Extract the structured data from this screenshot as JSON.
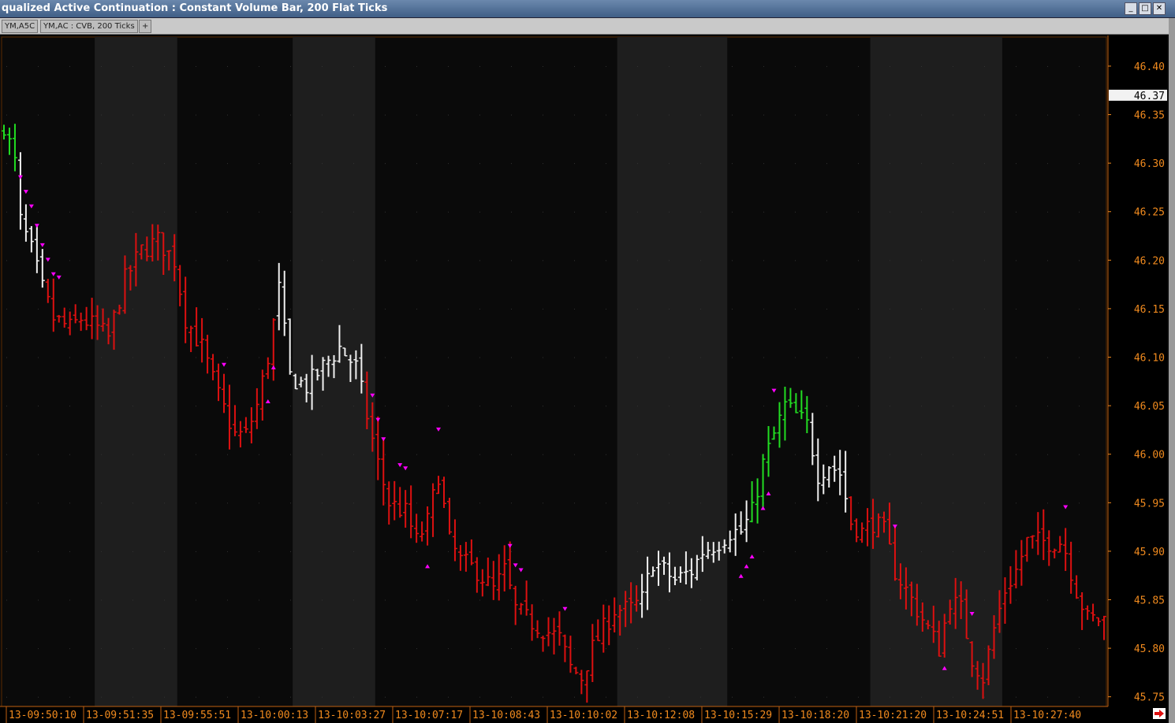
{
  "window": {
    "title": "qualized Active Continuation : Constant Volume Bar, 200 Flat Ticks",
    "buttons": {
      "minimize": "_",
      "maximize": "□",
      "close": "✕"
    }
  },
  "tabs": [
    {
      "label": "YM,A5C"
    },
    {
      "label": "YM,AC : CVB, 200 Ticks"
    },
    {
      "label": "+"
    }
  ],
  "colors": {
    "background": "#0a0a0a",
    "band": "#1e1e1e",
    "axis_text": "#f08a1e",
    "up": "#22dd22",
    "down": "#dd1010",
    "neutral": "#f0f0f0",
    "marker": "#ff00ff"
  },
  "chart_data": {
    "type": "bar",
    "style": "ohlc",
    "ylim": [
      45.74,
      46.43
    ],
    "yticks": [
      "46.40",
      "46.35",
      "46.30",
      "46.25",
      "46.20",
      "46.15",
      "46.10",
      "46.05",
      "46.00",
      "45.95",
      "45.90",
      "45.85",
      "45.80",
      "45.75"
    ],
    "current_price": "46.37",
    "xticks": [
      "13-09:50:10",
      "13-09:51:35",
      "13-09:55:51",
      "13-10:00:13",
      "13-10:03:27",
      "13-10:07:17",
      "13-10:08:43",
      "13-10:10:02",
      "13-10:12:08",
      "13-10:15:29",
      "13-10:18:20",
      "13-10:21:20",
      "13-10:24:51",
      "13-10:27:40"
    ],
    "n_bars": 201,
    "shaded_bar_ranges": [
      [
        17,
        31
      ],
      [
        53,
        67
      ],
      [
        112,
        131
      ],
      [
        158,
        181
      ]
    ],
    "segments": [
      {
        "bars": [
          0,
          3
        ],
        "color": "up"
      },
      {
        "bars": [
          3,
          8
        ],
        "color": "neutral"
      },
      {
        "bars": [
          8,
          50
        ],
        "color": "down"
      },
      {
        "bars": [
          50,
          66
        ],
        "color": "neutral"
      },
      {
        "bars": [
          66,
          116
        ],
        "color": "down"
      },
      {
        "bars": [
          116,
          136
        ],
        "color": "neutral"
      },
      {
        "bars": [
          136,
          147
        ],
        "color": "up"
      },
      {
        "bars": [
          147,
          154
        ],
        "color": "neutral"
      },
      {
        "bars": [
          154,
          201
        ],
        "color": "down"
      }
    ],
    "path_points": [
      [
        0,
        46.34
      ],
      [
        2,
        46.3
      ],
      [
        3,
        46.24
      ],
      [
        5,
        46.21
      ],
      [
        7,
        46.17
      ],
      [
        9,
        46.14
      ],
      [
        12,
        46.13
      ],
      [
        14,
        46.14
      ],
      [
        17,
        46.13
      ],
      [
        19,
        46.12
      ],
      [
        22,
        46.18
      ],
      [
        25,
        46.21
      ],
      [
        28,
        46.22
      ],
      [
        31,
        46.2
      ],
      [
        33,
        46.14
      ],
      [
        36,
        46.11
      ],
      [
        39,
        46.06
      ],
      [
        42,
        46.02
      ],
      [
        44,
        46.02
      ],
      [
        46,
        46.05
      ],
      [
        48,
        46.1
      ],
      [
        50,
        46.17
      ],
      [
        52,
        46.08
      ],
      [
        55,
        46.07
      ],
      [
        58,
        46.09
      ],
      [
        61,
        46.11
      ],
      [
        64,
        46.09
      ],
      [
        66,
        46.04
      ],
      [
        68,
        45.99
      ],
      [
        70,
        45.95
      ],
      [
        73,
        45.94
      ],
      [
        75,
        45.91
      ],
      [
        77,
        45.93
      ],
      [
        79,
        45.98
      ],
      [
        81,
        45.91
      ],
      [
        83,
        45.89
      ],
      [
        86,
        45.88
      ],
      [
        89,
        45.86
      ],
      [
        91,
        45.88
      ],
      [
        93,
        45.84
      ],
      [
        95,
        45.83
      ],
      [
        98,
        45.82
      ],
      [
        101,
        45.81
      ],
      [
        103,
        45.78
      ],
      [
        105,
        45.77
      ],
      [
        107,
        45.8
      ],
      [
        109,
        45.82
      ],
      [
        111,
        45.84
      ],
      [
        114,
        45.84
      ],
      [
        116,
        45.85
      ],
      [
        118,
        45.89
      ],
      [
        120,
        45.88
      ],
      [
        122,
        45.87
      ],
      [
        125,
        45.88
      ],
      [
        127,
        45.9
      ],
      [
        130,
        45.91
      ],
      [
        132,
        45.92
      ],
      [
        134,
        45.92
      ],
      [
        136,
        45.94
      ],
      [
        138,
        45.99
      ],
      [
        140,
        46.02
      ],
      [
        142,
        46.05
      ],
      [
        144,
        46.04
      ],
      [
        146,
        46.03
      ],
      [
        148,
        45.98
      ],
      [
        150,
        45.99
      ],
      [
        152,
        45.98
      ],
      [
        154,
        45.93
      ],
      [
        156,
        45.92
      ],
      [
        158,
        45.93
      ],
      [
        160,
        45.92
      ],
      [
        162,
        45.88
      ],
      [
        164,
        45.86
      ],
      [
        166,
        45.84
      ],
      [
        168,
        45.82
      ],
      [
        170,
        45.8
      ],
      [
        172,
        45.85
      ],
      [
        174,
        45.84
      ],
      [
        176,
        45.79
      ],
      [
        178,
        45.77
      ],
      [
        180,
        45.82
      ],
      [
        182,
        45.86
      ],
      [
        184,
        45.88
      ],
      [
        186,
        45.91
      ],
      [
        188,
        45.91
      ],
      [
        190,
        45.91
      ],
      [
        192,
        45.91
      ],
      [
        193,
        45.9
      ],
      [
        195,
        45.86
      ],
      [
        197,
        45.83
      ],
      [
        200,
        45.83
      ]
    ],
    "markers": [
      {
        "bar": 3,
        "dir": "down"
      },
      {
        "bar": 4,
        "dir": "down"
      },
      {
        "bar": 5,
        "dir": "down"
      },
      {
        "bar": 6,
        "dir": "down"
      },
      {
        "bar": 7,
        "dir": "down"
      },
      {
        "bar": 8,
        "dir": "down"
      },
      {
        "bar": 9,
        "dir": "down"
      },
      {
        "bar": 10,
        "dir": "down"
      },
      {
        "bar": 40,
        "dir": "down"
      },
      {
        "bar": 48,
        "dir": "up"
      },
      {
        "bar": 49,
        "dir": "up"
      },
      {
        "bar": 67,
        "dir": "down"
      },
      {
        "bar": 68,
        "dir": "down"
      },
      {
        "bar": 69,
        "dir": "down"
      },
      {
        "bar": 72,
        "dir": "down"
      },
      {
        "bar": 73,
        "dir": "down"
      },
      {
        "bar": 77,
        "dir": "up"
      },
      {
        "bar": 79,
        "dir": "down"
      },
      {
        "bar": 92,
        "dir": "down"
      },
      {
        "bar": 93,
        "dir": "down"
      },
      {
        "bar": 94,
        "dir": "down"
      },
      {
        "bar": 102,
        "dir": "down"
      },
      {
        "bar": 134,
        "dir": "up"
      },
      {
        "bar": 135,
        "dir": "up"
      },
      {
        "bar": 136,
        "dir": "up"
      },
      {
        "bar": 138,
        "dir": "up"
      },
      {
        "bar": 139,
        "dir": "up"
      },
      {
        "bar": 140,
        "dir": "down"
      },
      {
        "bar": 162,
        "dir": "down"
      },
      {
        "bar": 171,
        "dir": "up"
      },
      {
        "bar": 176,
        "dir": "down"
      },
      {
        "bar": 177,
        "dir": "up"
      },
      {
        "bar": 193,
        "dir": "down"
      }
    ]
  }
}
